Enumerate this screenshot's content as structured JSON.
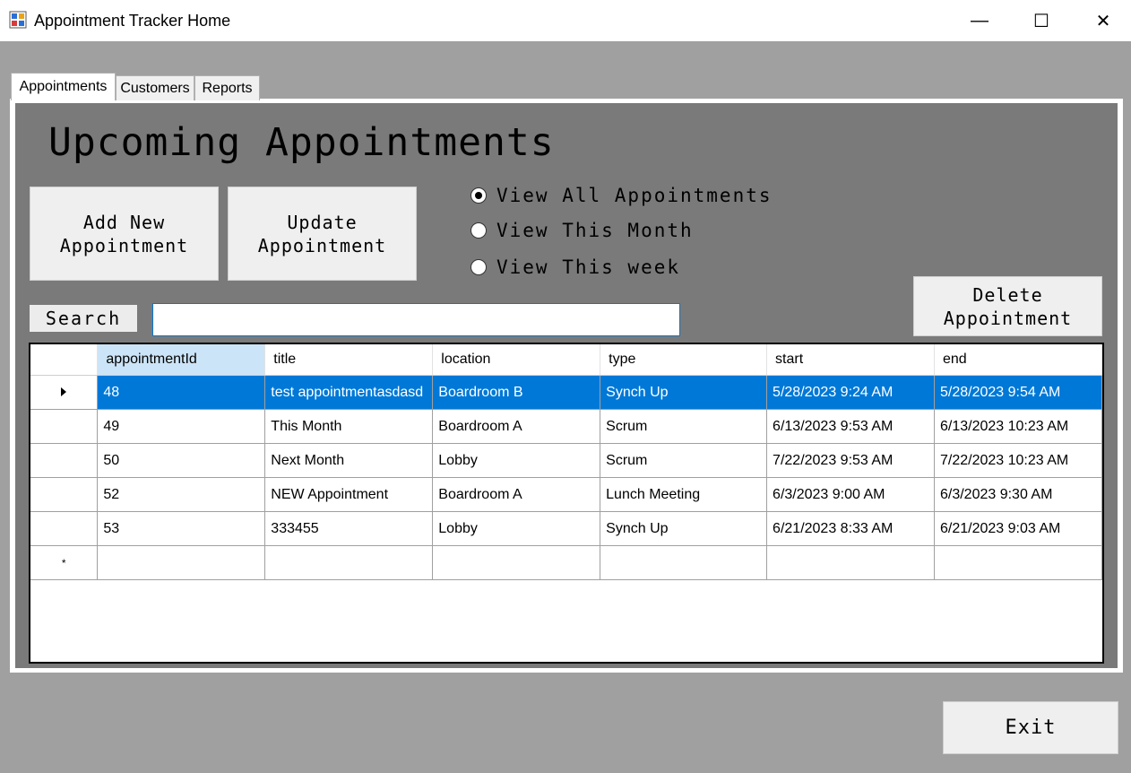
{
  "window": {
    "title": "Appointment Tracker Home",
    "minimize_glyph": "—",
    "maximize_glyph": "☐",
    "close_glyph": "✕"
  },
  "tabs": [
    {
      "label": "Appointments",
      "active": true
    },
    {
      "label": "Customers",
      "active": false
    },
    {
      "label": "Reports",
      "active": false
    }
  ],
  "main": {
    "heading": "Upcoming Appointments",
    "add_button_line1": "Add New",
    "add_button_line2": "Appointment",
    "update_button_line1": "Update",
    "update_button_line2": "Appointment",
    "delete_button_line1": "Delete",
    "delete_button_line2": "Appointment",
    "radios": [
      {
        "label": "View All Appointments",
        "checked": true
      },
      {
        "label": "View This Month",
        "checked": false
      },
      {
        "label": "View This week",
        "checked": false
      }
    ],
    "search_label": "Search",
    "search_value": ""
  },
  "grid": {
    "columns": [
      "appointmentId",
      "title",
      "location",
      "type",
      "start",
      "end"
    ],
    "rows": [
      [
        "48",
        "test appointmentasdasd",
        "Boardroom B",
        "Synch Up",
        "5/28/2023 9:24 AM",
        "5/28/2023 9:54 AM"
      ],
      [
        "49",
        "This Month",
        "Boardroom A",
        "Scrum",
        "6/13/2023 9:53 AM",
        "6/13/2023 10:23 AM"
      ],
      [
        "50",
        "Next Month",
        "Lobby",
        "Scrum",
        "7/22/2023 9:53 AM",
        "7/22/2023 10:23 AM"
      ],
      [
        "52",
        "NEW Appointment",
        "Boardroom A",
        "Lunch Meeting",
        "6/3/2023 9:00 AM",
        "6/3/2023 9:30 AM"
      ],
      [
        "53",
        "333455",
        "Lobby",
        "Synch Up",
        "6/21/2023 8:33 AM",
        "6/21/2023 9:03 AM"
      ]
    ],
    "selected_row": 0,
    "new_row_marker": "*"
  },
  "footer": {
    "exit_label": "Exit"
  },
  "colors": {
    "selection": "#0078d7",
    "panel": "#7a7a7a",
    "background": "#a0a0a0"
  }
}
